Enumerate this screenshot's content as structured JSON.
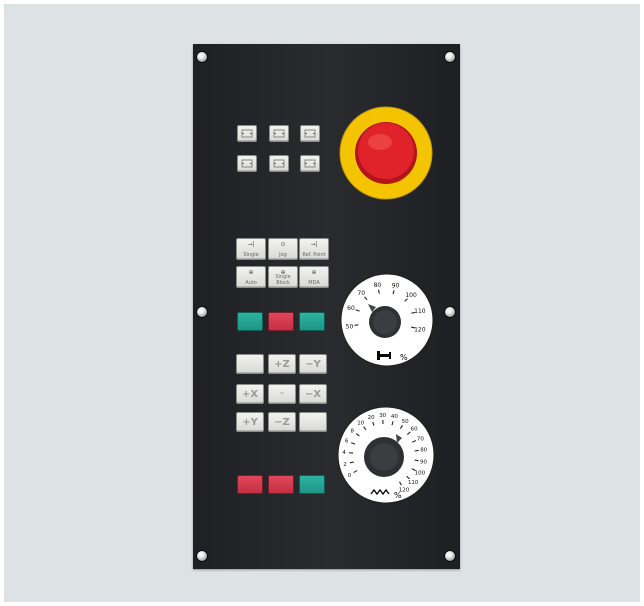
{
  "panel": {
    "colors": {
      "body": "#26272a",
      "key": "#e6e6e2",
      "red": "#d13a4e",
      "green": "#25a594",
      "estop_ring": "#f4c400",
      "estop_cap": "#e0232a"
    }
  },
  "mode_keys": [
    {
      "symbol": "→|",
      "label": "Single"
    },
    {
      "symbol": "⊙",
      "label": "Jog"
    },
    {
      "symbol": "→|",
      "label": "Ref. Point"
    },
    {
      "symbol": "⊕",
      "label": "Auto"
    },
    {
      "symbol": "⊕",
      "label": "Single Block"
    },
    {
      "symbol": "⊕",
      "label": "MDA"
    }
  ],
  "jog_keys": [
    "",
    "+Z",
    "−Y",
    "+X",
    "",
    "−X",
    "+Y",
    "−Z",
    ""
  ],
  "jog_center_label": "~",
  "spindle_dial": {
    "icon": "spindle-icon",
    "percent_sign": "%",
    "ticks": [
      "50",
      "60",
      "70",
      "80",
      "90",
      "100",
      "110",
      "120"
    ]
  },
  "feed_dial": {
    "icon": "feed-icon",
    "percent_sign": "%",
    "ticks": [
      "0",
      "2",
      "4",
      "6",
      "8",
      "10",
      "20",
      "30",
      "40",
      "50",
      "60",
      "70",
      "80",
      "90",
      "100",
      "110",
      "120"
    ]
  }
}
